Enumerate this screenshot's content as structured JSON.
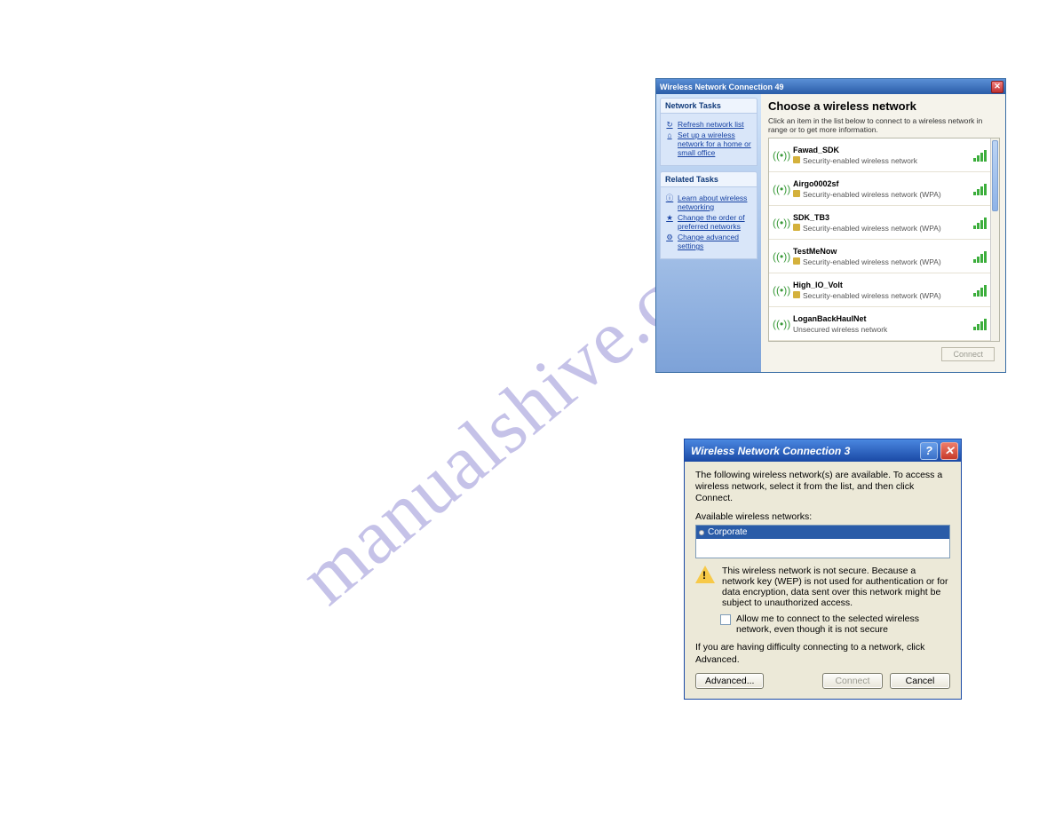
{
  "watermark": "manualshive.com",
  "win1": {
    "title": "Wireless Network Connection 49",
    "sidebar": {
      "group1_title": "Network Tasks",
      "group1_links": [
        {
          "icon": "refresh-icon",
          "label": "Refresh network list"
        },
        {
          "icon": "home-icon",
          "label": "Set up a wireless network for a home or small office"
        }
      ],
      "group2_title": "Related Tasks",
      "group2_links": [
        {
          "icon": "info-icon",
          "label": "Learn about wireless networking"
        },
        {
          "icon": "star-icon",
          "label": "Change the order of preferred networks"
        },
        {
          "icon": "gear-icon",
          "label": "Change advanced settings"
        }
      ]
    },
    "main": {
      "heading": "Choose a wireless network",
      "intro": "Click an item in the list below to connect to a wireless network in range or to get more information.",
      "networks": [
        {
          "name": "Fawad_SDK",
          "security": "Security-enabled wireless network"
        },
        {
          "name": "Airgo0002sf",
          "security": "Security-enabled wireless network (WPA)"
        },
        {
          "name": "SDK_TB3",
          "security": "Security-enabled wireless network (WPA)"
        },
        {
          "name": "TestMeNow",
          "security": "Security-enabled wireless network (WPA)"
        },
        {
          "name": "High_IO_Volt",
          "security": "Security-enabled wireless network (WPA)"
        },
        {
          "name": "LoganBackHaulNet",
          "security": "Unsecured wireless network"
        }
      ],
      "connect_label": "Connect"
    }
  },
  "win2": {
    "title": "Wireless Network Connection 3",
    "intro": "The following wireless network(s) are available. To access a wireless network, select it from the list, and then click Connect.",
    "available_label": "Available wireless networks:",
    "list_item": "Corporate",
    "warning": "This wireless network is not secure. Because a network key (WEP) is not used for authentication or for data encryption, data sent over this network might be subject to unauthorized access.",
    "checkbox_label": "Allow me to connect to the selected wireless network, even though it is not secure",
    "difficulty_note": "If you are having difficulty connecting to a network, click Advanced.",
    "buttons": {
      "advanced": "Advanced...",
      "connect": "Connect",
      "cancel": "Cancel"
    }
  }
}
